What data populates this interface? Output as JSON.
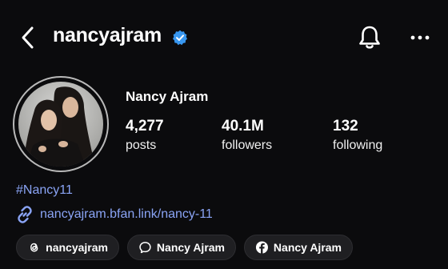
{
  "header": {
    "username": "nancyajram",
    "verified": true,
    "back_icon": "chevron-left-icon",
    "notification_icon": "bell-icon",
    "more_icon": "ellipsis-icon"
  },
  "profile": {
    "display_name": "Nancy Ajram",
    "stats": [
      {
        "value": "4,277",
        "label": "posts"
      },
      {
        "value": "40.1M",
        "label": "followers"
      },
      {
        "value": "132",
        "label": "following"
      }
    ],
    "hashtag": "#Nancy11",
    "link": "nancyajram.bfan.link/nancy-11"
  },
  "pills": [
    {
      "icon": "threads-icon",
      "label": "nancyajram"
    },
    {
      "icon": "chat-bubble-icon",
      "label": "Nancy Ajram"
    },
    {
      "icon": "facebook-icon",
      "label": "Nancy Ajram"
    }
  ],
  "colors": {
    "background": "#0b0b0d",
    "link": "#8aa4f5",
    "verified_badge": "#3897f0",
    "pill_background": "#1f1f22"
  }
}
